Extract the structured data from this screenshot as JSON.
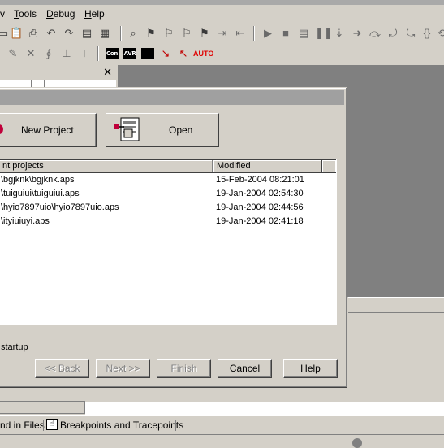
{
  "menu": {
    "partial": "v",
    "tools": "Tools",
    "tools_key": "T",
    "debug": "Debug",
    "debug_key": "D",
    "help": "Help",
    "help_key": "H"
  },
  "toolbar2": {
    "tag_con": "Con",
    "tag_avr": "AVR",
    "tag_auto": "AUTO"
  },
  "left_pane": {
    "close_glyph": "✕"
  },
  "dialog": {
    "new_project_label": "New Project",
    "open_label": "Open",
    "projects": {
      "col_name": "nt projects",
      "col_modified": "Modified",
      "rows": [
        {
          "path": "\\bgjknk\\bgjknk.aps",
          "modified": "15-Feb-2004 08:21:01"
        },
        {
          "path": "\\tuiguiui\\tuiguiui.aps",
          "modified": "19-Jan-2004 02:54:30"
        },
        {
          "path": "\\hyio7897uio\\hyio7897uio.aps",
          "modified": "19-Jan-2004 02:44:56"
        },
        {
          "path": "\\ityiuiuyi.aps",
          "modified": "19-Jan-2004 02:41:18"
        }
      ]
    },
    "startup_text": "startup",
    "buttons": {
      "back": "<< Back",
      "next": "Next >>",
      "finish": "Finish",
      "cancel": "Cancel",
      "help": "Help"
    }
  },
  "bottom_tabs": {
    "find_in_files": "nd in Files",
    "breakpoints": "Breakpoints and Tracepoints"
  },
  "colors": {
    "workspace": "#808080",
    "face": "#d4d0c8",
    "auto_red": "#e00000"
  }
}
